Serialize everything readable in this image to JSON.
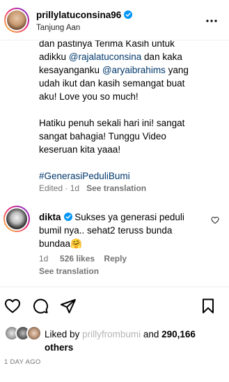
{
  "header": {
    "username": "prillylatuconsina96",
    "location": "Tanjung Aan"
  },
  "caption": {
    "line1": "dan pastinya Terima Kasih untuk",
    "line2_prefix": "adikku ",
    "line2_mention": "@rajalatuconsina",
    "line2_suffix": " dan kaka",
    "line3_prefix": "kesayanganku ",
    "line3_mention": "@aryaibrahims",
    "line3_suffix": " yang",
    "line4": "udah ikut dan kasih semangat buat",
    "line5": "aku! Love you so much!",
    "line6": "Hatiku penuh sekali hari ini! sangat",
    "line7": "sangat bahagia! Tunggu Video",
    "line8": "keseruan kita yaaa!",
    "hashtag": "#GenerasiPeduliBumi",
    "edited": "Edited",
    "dot": "·",
    "time": "1d",
    "see_translation": "See translation"
  },
  "comment": {
    "username": "dikta",
    "text_line1": " Sukses ya generasi peduli",
    "text_line2": "bumil nya.. sehat2 teruss bunda",
    "text_line3": "bundaa🤗",
    "time": "1d",
    "likes": "526 likes",
    "reply": "Reply",
    "see_translation": "See translation"
  },
  "likes": {
    "prefix": "Liked by",
    "blurred_user": "prillyfrombumi",
    "and": " and ",
    "count": "290,166",
    "others": "others"
  },
  "timestamp": "1 DAY AGO",
  "colors": {
    "link": "#00376b",
    "verified": "#0095f6",
    "secondary": "#737373"
  }
}
